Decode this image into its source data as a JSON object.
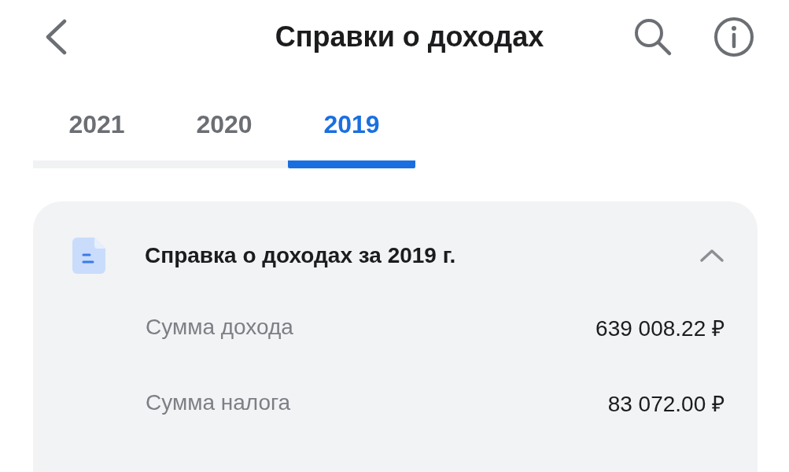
{
  "header": {
    "title": "Справки о доходах"
  },
  "tabs": [
    {
      "label": "2021",
      "selected": false
    },
    {
      "label": "2020",
      "selected": false
    },
    {
      "label": "2019",
      "selected": true
    }
  ],
  "card": {
    "title": "Справка о доходах за 2019 г.",
    "expanded": true,
    "rows": [
      {
        "label": "Сумма дохода",
        "value": "639 008.22 ₽"
      },
      {
        "label": "Сумма налога",
        "value": "83 072.00 ₽"
      }
    ]
  }
}
